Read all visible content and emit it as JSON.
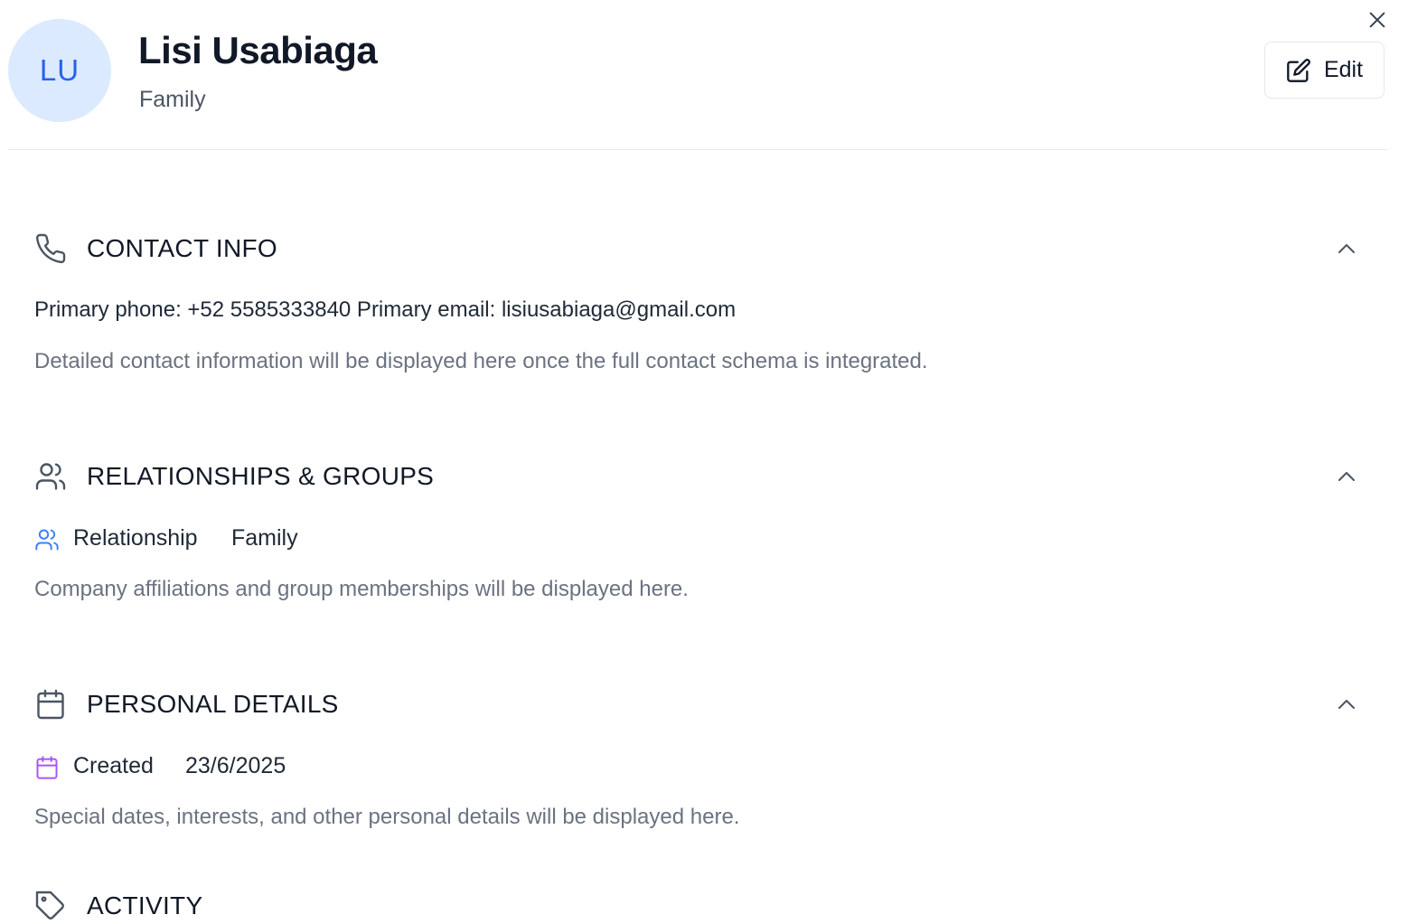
{
  "header": {
    "avatar_initials": "LU",
    "name": "Lisi Usabiaga",
    "subtitle": "Family",
    "edit_label": "Edit"
  },
  "sections": {
    "contact": {
      "title": "CONTACT INFO",
      "primary_line": "Primary phone: +52 5585333840 Primary email: lisiusabiaga@gmail.com",
      "note": "Detailed contact information will be displayed here once the full contact schema is integrated."
    },
    "relationships": {
      "title": "RELATIONSHIPS & GROUPS",
      "field_label": "Relationship",
      "field_value": "Family",
      "note": "Company affiliations and group memberships will be displayed here."
    },
    "personal": {
      "title": "PERSONAL DETAILS",
      "field_label": "Created",
      "field_value": "23/6/2025",
      "note": "Special dates, interests, and other personal details will be displayed here."
    },
    "activity": {
      "title": "ACTIVITY"
    }
  },
  "icons": {
    "close": "close-icon",
    "edit": "edit-icon",
    "contact": "phone-icon",
    "relationships": "users-icon",
    "personal": "calendar-icon",
    "activity": "tag-icon",
    "collapse": "chevron-up-icon"
  },
  "colors": {
    "avatar_bg": "#dbeafe",
    "avatar_text": "#2563eb",
    "relationship_icon": "#3b82f6",
    "created_icon": "#a855f7",
    "muted_text": "#6b7280"
  }
}
